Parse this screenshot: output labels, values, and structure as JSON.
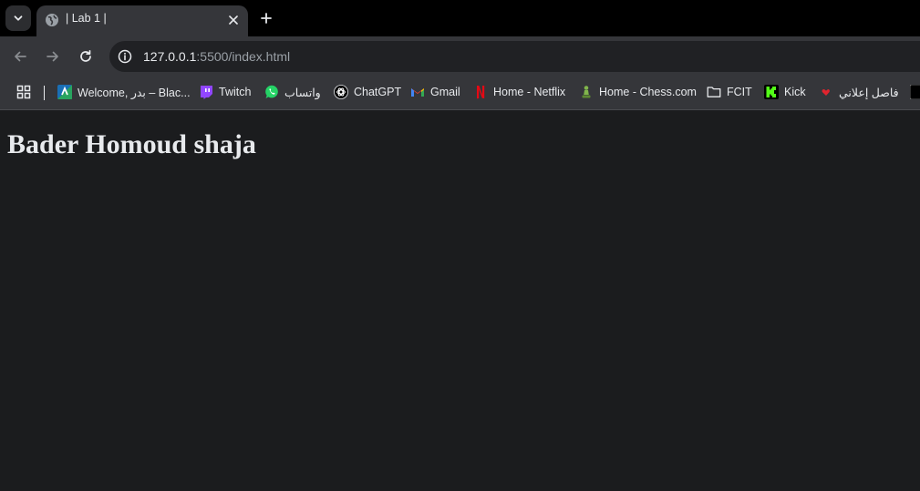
{
  "tab": {
    "title": "| Lab 1 |"
  },
  "toolbar": {
    "url_host": "127.0.0.1",
    "url_rest": ":5500/index.html"
  },
  "bookmarks": [
    {
      "label": "Welcome, بدر – Blac...",
      "icon": "blackboard-icon"
    },
    {
      "label": "Twitch",
      "icon": "twitch-icon"
    },
    {
      "label": "واتساب",
      "icon": "whatsapp-icon"
    },
    {
      "label": "ChatGPT",
      "icon": "chatgpt-icon"
    },
    {
      "label": "Gmail",
      "icon": "gmail-icon"
    },
    {
      "label": "Home - Netflix",
      "icon": "netflix-icon"
    },
    {
      "label": "Home - Chess.com",
      "icon": "chess-icon"
    },
    {
      "label": "FCIT",
      "icon": "folder-icon"
    },
    {
      "label": "Kick",
      "icon": "kick-icon"
    },
    {
      "label": "فاصل إعلاني",
      "icon": "heart-icon"
    }
  ],
  "page": {
    "heading": "Bader Homoud shaja"
  },
  "colors": {
    "tabstrip": "#000000",
    "toolbar": "#35363a",
    "omnibox": "#202124",
    "content_bg": "#1b1c1e",
    "text": "#e8eaed"
  }
}
